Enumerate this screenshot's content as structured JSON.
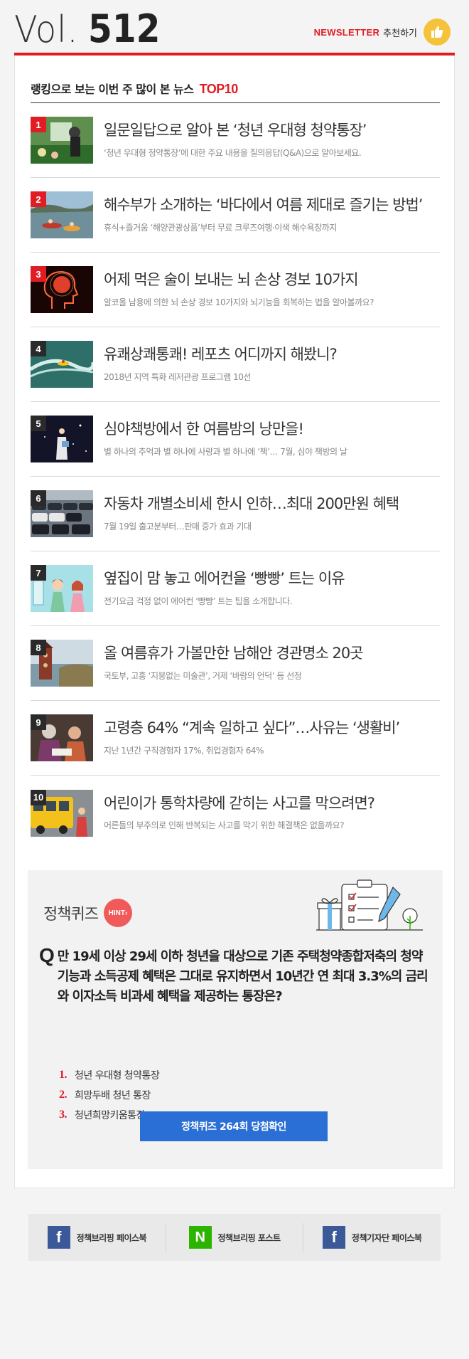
{
  "header": {
    "vol_prefix": "Vol.",
    "vol_number": "512",
    "newsletter_label": "NEWSLETTER",
    "recommend_label": "추천하기"
  },
  "ranking": {
    "title": "랭킹으로 보는 이번 주 많이 본 뉴스",
    "title_highlight": "TOP10",
    "items": [
      {
        "rank": "1",
        "title": "일문일답으로 알아 본 ‘청년 우대형 청약통장’",
        "sub": "‘청년 우대형 청약통장’에 대한 주요 내용을 질의응답(Q&A)으로 알아보세요."
      },
      {
        "rank": "2",
        "title": "해수부가 소개하는 ‘바다에서 여름 제대로 즐기는 방법’",
        "sub": "휴식+즐거움 ‘해양관광상품’부터 무료 크루즈여행·이색 해수욕장까지"
      },
      {
        "rank": "3",
        "title": "어제 먹은 술이 보내는 뇌 손상 경보 10가지",
        "sub": "알코올 남용에 의한 뇌 손상 경보 10가지와 뇌기능을 회복하는 법을 알아볼까요?"
      },
      {
        "rank": "4",
        "title": "유쾌상쾌통쾌! 레포츠 어디까지 해봤니?",
        "sub": "2018년 지역 특화 레저관광 프로그램 10선"
      },
      {
        "rank": "5",
        "title": "심야책방에서 한 여름밤의 낭만을!",
        "sub": "별 하나의 추억과 별 하나에 사랑과 별 하나에 ‘책’… 7월, 심야 책방의 날"
      },
      {
        "rank": "6",
        "title": "자동차 개별소비세 한시 인하…최대 200만원 혜택",
        "sub": "7월 19일 출고분부터…판매 증가 효과 기대"
      },
      {
        "rank": "7",
        "title": "옆집이 맘 놓고 에어컨을 ‘빵빵’ 트는 이유",
        "sub": "전기요금 걱정 없이 에어컨 ‘빵빵’ 트는 팁을 소개합니다."
      },
      {
        "rank": "8",
        "title": "올 여름휴가 가볼만한 남해안 경관명소 20곳",
        "sub": "국토부, 고흥 ‘지붕없는 미술관’, 거제 ‘바람의 언덕’ 등 선정"
      },
      {
        "rank": "9",
        "title": "고령층 64% “계속 일하고 싶다”…사유는 ‘생활비’",
        "sub": "지난 1년간 구직경험자 17%, 취업경험자 64%"
      },
      {
        "rank": "10",
        "title": "어린이가 통학차량에 갇히는 사고를 막으려면?",
        "sub": "어른들의 부주의로 인해 반복되는 사고를 막기 위한 해결책은 없을까요?"
      }
    ]
  },
  "quiz": {
    "label": "정책퀴즈",
    "hint": "HINT",
    "q_mark": "Q",
    "question": "만 19세 이상 29세 이하 청년을 대상으로 기존 주택청약종합저축의 청약 기능과 소득공제 혜택은 그대로 유지하면서 10년간 연 최대 3.3%의 금리와 이자소득 비과세 혜택을 제공하는 통장은?",
    "options": [
      {
        "num": "1.",
        "text": "청년 우대형 청약통장"
      },
      {
        "num": "2.",
        "text": "희망두배 청년 통장"
      },
      {
        "num": "3.",
        "text": "청년희망키움통장"
      }
    ],
    "button": "정책퀴즈 264회 당첨확인"
  },
  "footer": {
    "links": [
      {
        "icon": "f",
        "label": "정책브리핑 페이스북"
      },
      {
        "icon": "N",
        "label": "정책브리핑 포스트"
      },
      {
        "icon": "f",
        "label": "정책기자단 페이스북"
      }
    ]
  },
  "colors": {
    "accent_red": "#e01d24",
    "button_blue": "#2a6fd6",
    "facebook": "#3b5998",
    "naver": "#2db400",
    "thumb_yellow": "#f5c33b"
  }
}
